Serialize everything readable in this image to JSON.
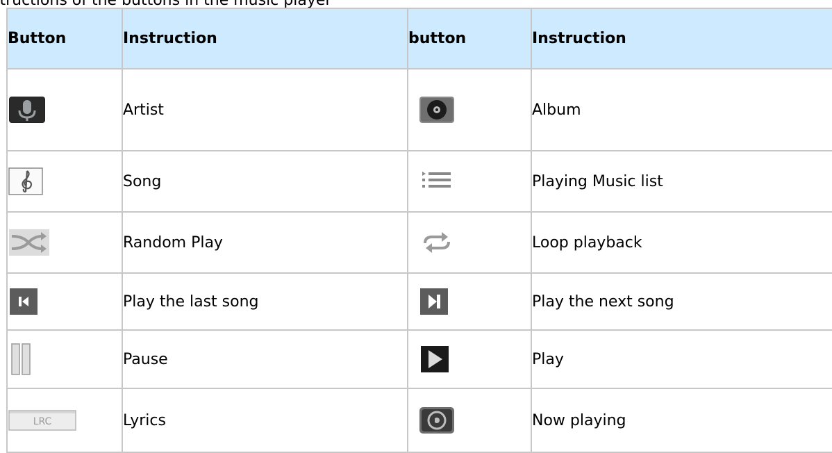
{
  "caption": "structions of the buttons in the music player",
  "table": {
    "headers": [
      "Button",
      "Instruction",
      "button",
      "Instruction"
    ],
    "rows": [
      {
        "left_icon": "microphone-icon",
        "left_label": "Artist",
        "right_icon": "album-disc-icon",
        "right_label": "Album"
      },
      {
        "left_icon": "treble-clef-icon",
        "left_label": "Song",
        "right_icon": "playlist-icon",
        "right_label": "Playing Music list"
      },
      {
        "left_icon": "shuffle-icon",
        "left_label": "Random Play",
        "right_icon": "repeat-icon",
        "right_label": "Loop playback"
      },
      {
        "left_icon": "previous-track-icon",
        "left_label": "Play the last song",
        "right_icon": "next-track-icon",
        "right_label": "Play the next song"
      },
      {
        "left_icon": "pause-icon",
        "left_label": "Pause",
        "right_icon": "play-icon",
        "right_label": "Play"
      },
      {
        "left_icon": "lrc-lyrics-icon",
        "left_label": "Lyrics",
        "right_icon": "now-playing-icon",
        "right_label": "Now playing"
      }
    ],
    "icon_text": {
      "lrc": "LRC"
    }
  }
}
